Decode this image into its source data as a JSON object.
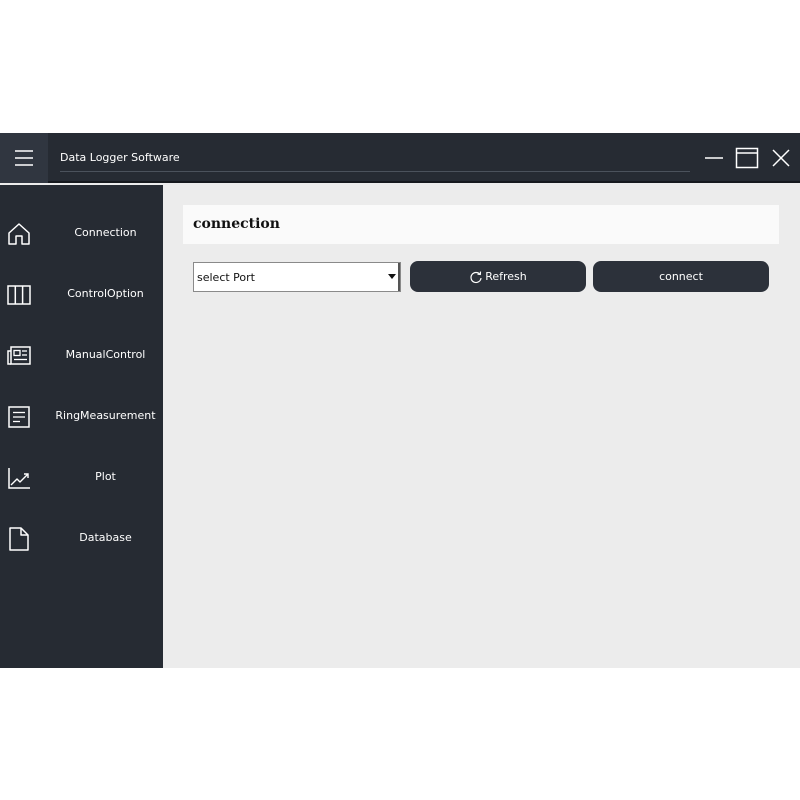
{
  "window": {
    "title": "Data Logger Software"
  },
  "sidebar": {
    "items": [
      {
        "label": "Connection",
        "icon": "home-icon"
      },
      {
        "label": "ControlOption",
        "icon": "columns-icon"
      },
      {
        "label": "ManualControl",
        "icon": "newspaper-icon"
      },
      {
        "label": "RingMeasurement",
        "icon": "document-text-icon"
      },
      {
        "label": "Plot",
        "icon": "chart-line-icon"
      },
      {
        "label": "Database",
        "icon": "file-icon"
      }
    ]
  },
  "main": {
    "title": "connection",
    "port_select": {
      "selected": "select Port"
    },
    "refresh_label": "Refresh",
    "connect_label": "connect"
  },
  "colors": {
    "titlebar": "#262b33",
    "sidebar": "#262b33",
    "content_bg": "#ececec",
    "button": "#2c313a",
    "text_light": "#ffffff"
  }
}
